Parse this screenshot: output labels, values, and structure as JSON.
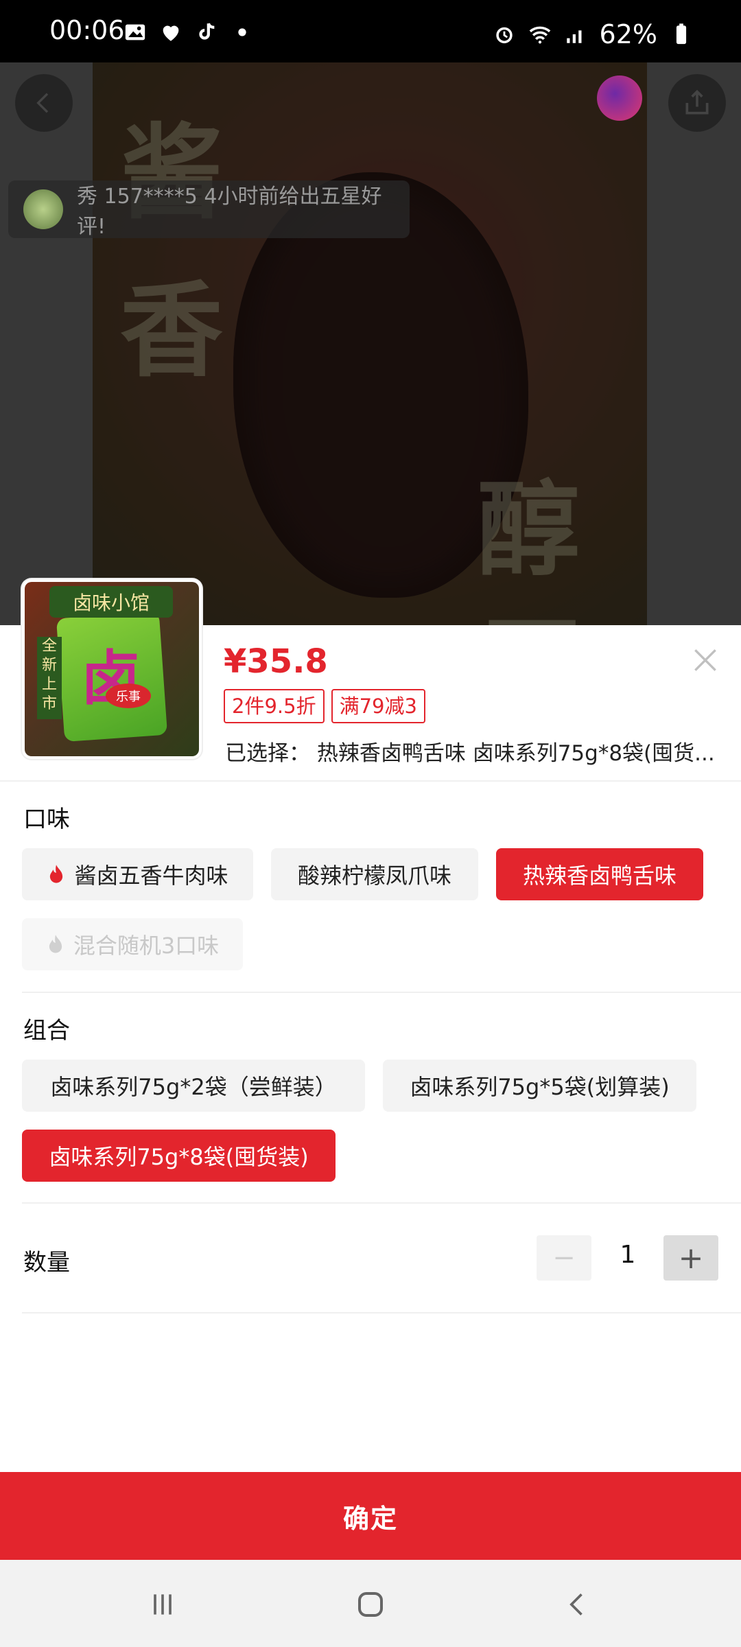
{
  "status_bar": {
    "time": "00:06",
    "battery": "62%",
    "left_icons": [
      "image-icon",
      "heart-icon",
      "tiktok-icon",
      "dot-icon"
    ],
    "right_icons": [
      "alarm-icon",
      "wifi-icon",
      "signal-icon",
      "battery-icon"
    ]
  },
  "hero": {
    "review_text": "秀 157****5 4小时前给出五星好评!",
    "poster_chars": [
      "酱",
      "香",
      "醇",
      "厚"
    ]
  },
  "product": {
    "price": "¥35.8",
    "tags": [
      "2件9.5折",
      "满79减3"
    ],
    "selected_label": "已选择：",
    "selected_value": "热辣香卤鸭舌味 卤味系列75g*8袋(囤货...",
    "thumb_sign": "卤味小馆",
    "thumb_side": "全新上市",
    "thumb_big": "卤",
    "thumb_logo": "乐事"
  },
  "flavor": {
    "title": "口味",
    "options": [
      {
        "label": "酱卤五香牛肉味",
        "state": "normal",
        "icon": "flame-icon"
      },
      {
        "label": "酸辣柠檬凤爪味",
        "state": "normal"
      },
      {
        "label": "热辣香卤鸭舌味",
        "state": "selected"
      },
      {
        "label": "混合随机3口味",
        "state": "disabled",
        "icon": "flame-icon"
      }
    ]
  },
  "combo": {
    "title": "组合",
    "options": [
      {
        "label": "卤味系列75g*2袋（尝鲜装）",
        "state": "normal"
      },
      {
        "label": "卤味系列75g*5袋(划算装)",
        "state": "normal"
      },
      {
        "label": "卤味系列75g*8袋(囤货装)",
        "state": "selected"
      }
    ]
  },
  "quantity": {
    "label": "数量",
    "value": "1",
    "minus": "−",
    "plus": "+"
  },
  "confirm_label": "确定",
  "colors": {
    "accent": "#e3252d",
    "chip_bg": "#f3f3f3"
  }
}
